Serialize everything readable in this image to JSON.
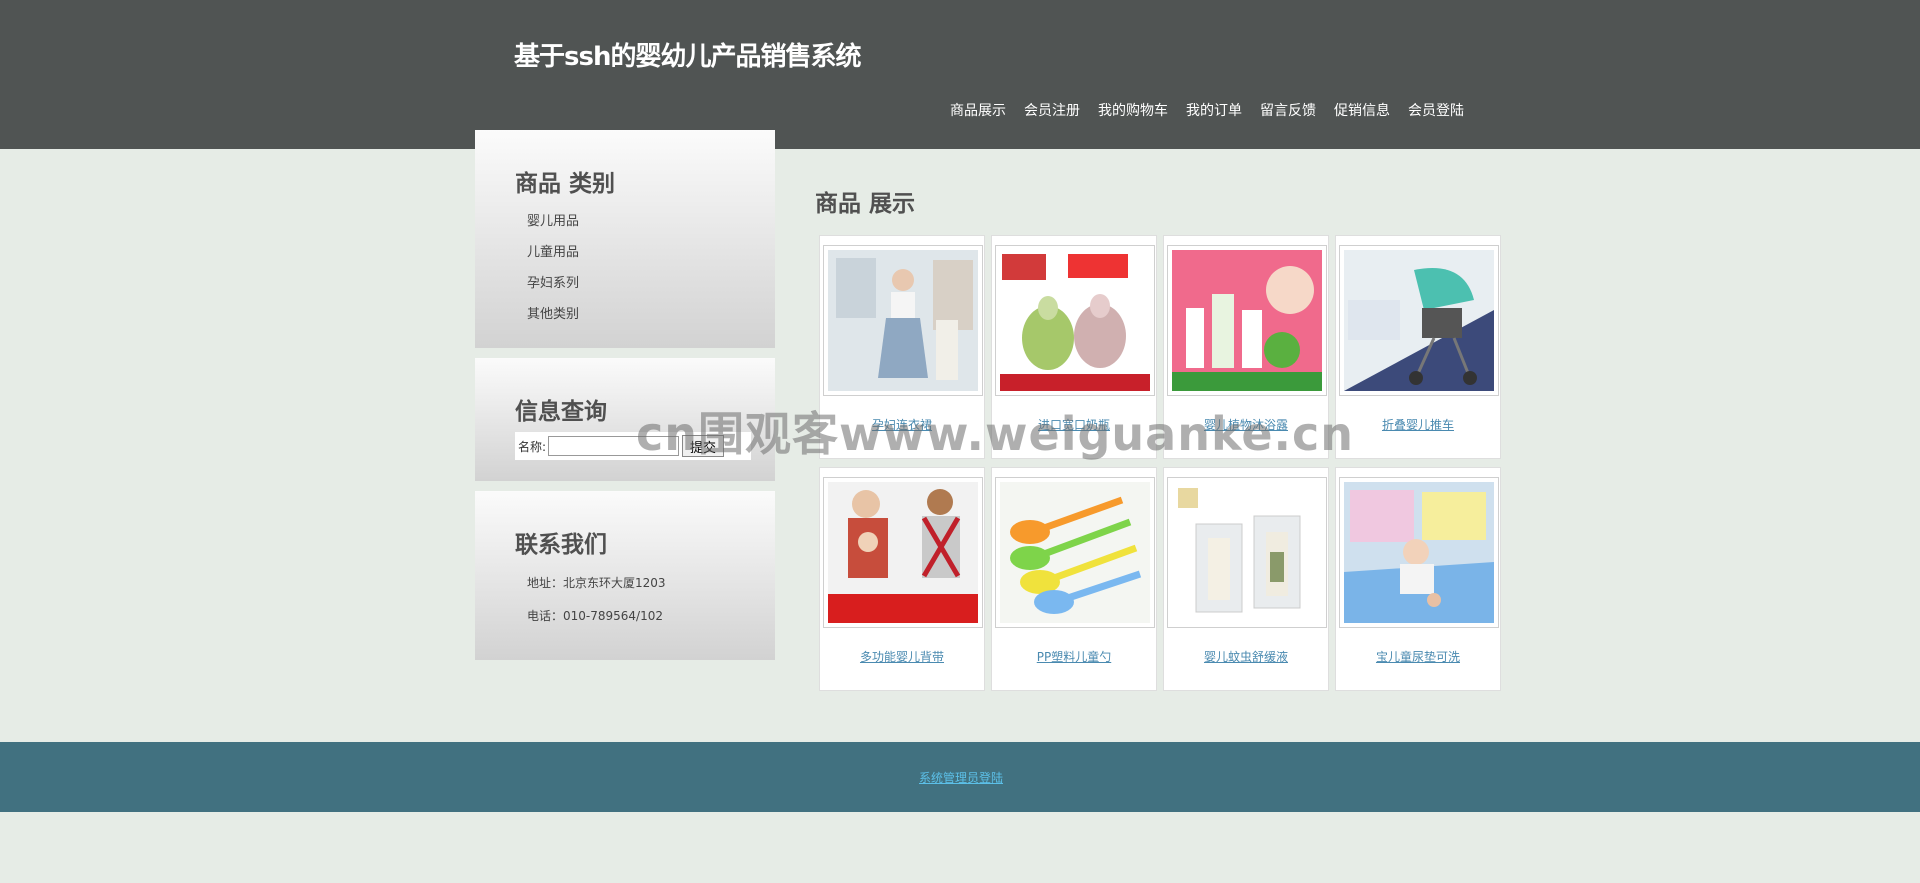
{
  "header": {
    "site_title": "基于ssh的婴幼儿产品销售系统",
    "nav": [
      "商品展示",
      "会员注册",
      "我的购物车",
      "我的订单",
      "留言反馈",
      "促销信息",
      "会员登陆"
    ]
  },
  "sidebar": {
    "categories_title": "商品 类别",
    "categories": [
      "婴儿用品",
      "儿童用品",
      "孕妇系列",
      "其他类别"
    ],
    "search_title": "信息查询",
    "search_label": "名称:",
    "search_value": "",
    "search_button": "提交",
    "contact_title": "联系我们",
    "address": "地址：北京东环大厦1203",
    "phone": "电话：010-789564/102"
  },
  "main": {
    "title": "商品 展示",
    "products": [
      {
        "name": "孕妇连衣裙",
        "icon": "dress-image"
      },
      {
        "name": "进口宽口奶瓶",
        "icon": "baby-bottle-image"
      },
      {
        "name": "婴儿植物沐浴露",
        "icon": "body-wash-image"
      },
      {
        "name": "折叠婴儿推车",
        "icon": "stroller-image"
      },
      {
        "name": "多功能婴儿背带",
        "icon": "baby-carrier-image"
      },
      {
        "name": "PP塑料儿童勺",
        "icon": "spoon-image"
      },
      {
        "name": "婴儿蚊虫舒缓液",
        "icon": "lotion-image"
      },
      {
        "name": "宝儿童尿垫可洗",
        "icon": "diaper-pad-image"
      }
    ]
  },
  "footer": {
    "admin_link": "系统管理员登陆"
  },
  "watermark": "cn围观客www.weiguanke.cn",
  "colors": {
    "header_bg": "#505453",
    "page_bg": "#e6ece6",
    "footer_bg": "#417180",
    "link": "#4a8ab0"
  }
}
